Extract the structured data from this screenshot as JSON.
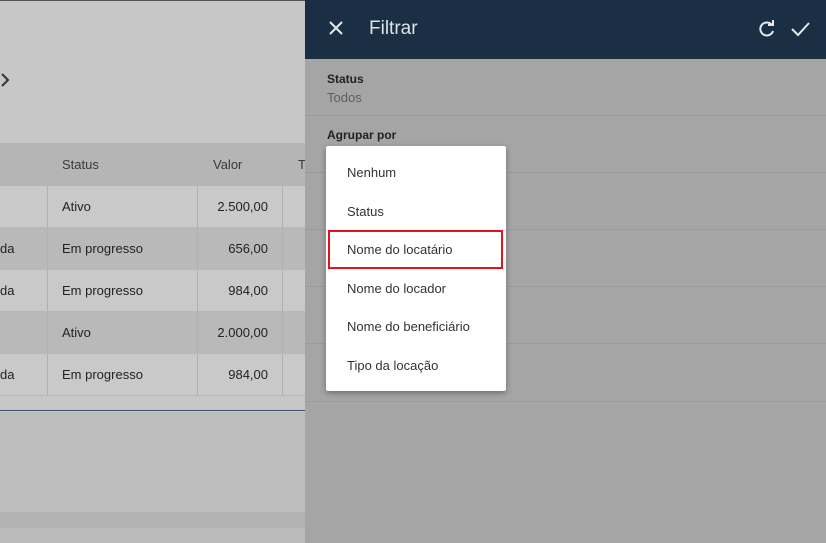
{
  "background": {
    "table": {
      "headers": [
        "Status",
        "Valor",
        "T"
      ],
      "rows": [
        {
          "prefix": "",
          "status": "Ativo",
          "valor": "2.500,00"
        },
        {
          "prefix": "da",
          "status": "Em progresso",
          "valor": "656,00"
        },
        {
          "prefix": "da",
          "status": "Em progresso",
          "valor": "984,00"
        },
        {
          "prefix": "",
          "status": "Ativo",
          "valor": "2.000,00"
        },
        {
          "prefix": "da",
          "status": "Em progresso",
          "valor": "984,00"
        }
      ]
    }
  },
  "panel": {
    "title": "Filtrar",
    "fields": {
      "status_label": "Status",
      "status_value": "Todos",
      "group_label": "Agrupar por"
    }
  },
  "dropdown": {
    "options": [
      "Nenhum",
      "Status",
      "Nome do locatário",
      "Nome do locador",
      "Nome do beneficiário",
      "Tipo da locação"
    ],
    "highlighted_index": 2,
    "highlight_color": "#e0131a"
  },
  "colors": {
    "header_bg": "#1a2f43",
    "panel_bg": "#a5a5a5",
    "dropdown_bg": "#ffffff"
  },
  "icons": {
    "close": "close-icon",
    "refresh": "refresh-icon",
    "apply": "check-icon",
    "back": "chevron-right-icon"
  }
}
